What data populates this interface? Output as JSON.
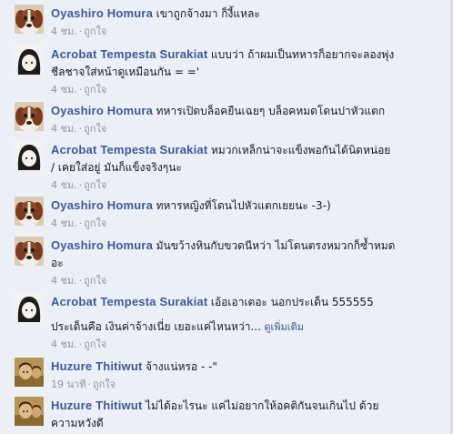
{
  "comments": [
    {
      "author": "Oyashiro Homura",
      "avatar": "dog-avatar",
      "line1": "เขาถูกจ้างมา ก็งี้แหละ",
      "line2": "",
      "extra": "",
      "see_more": "",
      "time": "4 ชม.",
      "like": "ถูกใจ"
    },
    {
      "author": "Acrobat Tempesta Surakiat",
      "avatar": "girl-avatar",
      "line1": "แบบว่า ถ้าผมเป็นทหารก็อยากจะลองพุ่ง",
      "line2": "ชีลชาจใส่หน้าดูเหมือนกัน = ='",
      "extra": "",
      "see_more": "",
      "time": "4 ชม.",
      "like": "ถูกใจ"
    },
    {
      "author": "Oyashiro Homura",
      "avatar": "dog-avatar",
      "line1": "ทหารเปิดบล็อคยืนเฉยๆ บล็อคหมดโดนปาหัวแตก",
      "line2": "",
      "extra": "",
      "see_more": "",
      "time": "4 ชม.",
      "like": "ถูกใจ"
    },
    {
      "author": "Acrobat Tempesta Surakiat",
      "avatar": "girl-avatar",
      "line1": "หมวกเหล็กน่าจะแข็งพอกันได้นิดหน่อย",
      "line2": "/ เคยใส่อยู่ มันก็แข็งจริงๆนะ",
      "extra": "",
      "see_more": "",
      "time": "4 ชม.",
      "like": "ถูกใจ"
    },
    {
      "author": "Oyashiro Homura",
      "avatar": "dog-avatar",
      "line1": "ทหารหญิงที่โดนไปหัวแตกเยยนะ -3-)",
      "line2": "",
      "extra": "",
      "see_more": "",
      "time": "4 ชม.",
      "like": "ถูกใจ"
    },
    {
      "author": "Oyashiro Homura",
      "avatar": "dog-avatar",
      "line1": "มันขว้างหินกับขวดนีหว่า ไม่โดนตรงหมวกก็ซ้ำหมด",
      "line2": "อะ",
      "extra": "",
      "see_more": "",
      "time": "4 ชม.",
      "like": "ถูกใจ"
    },
    {
      "author": "Acrobat Tempesta Surakiat",
      "avatar": "girl-avatar",
      "line1": "เอ้อเอาเตอะ นอกประเด็น 555555",
      "line2": "",
      "extra": "ประเด็นคือ เงินค่าจ้างเนี่ย เยอะแค่ไหนหว่า...",
      "see_more": "ดูเพิ่มเติม",
      "time": "4 ชม.",
      "like": "ถูกใจ"
    },
    {
      "author": "Huzure Thitiwut",
      "avatar": "huzure-avatar",
      "line1": "จ้างแน่หรอ - -\"",
      "line2": "",
      "extra": "",
      "see_more": "",
      "time": "19 นาที",
      "like": "ถูกใจ"
    },
    {
      "author": "Huzure Thitiwut",
      "avatar": "huzure-avatar",
      "line1": "ไม่ได้อะไรนะ แค่ไม่อยากให้อคติกันจนเกินไป ด้วย",
      "line2": "ความหวังดี",
      "extra": "",
      "see_more": "",
      "time": "",
      "like": ""
    }
  ],
  "separator": "·",
  "colors": {
    "link": "#3b5998",
    "meta": "#90949c",
    "background": "#eceff5"
  }
}
